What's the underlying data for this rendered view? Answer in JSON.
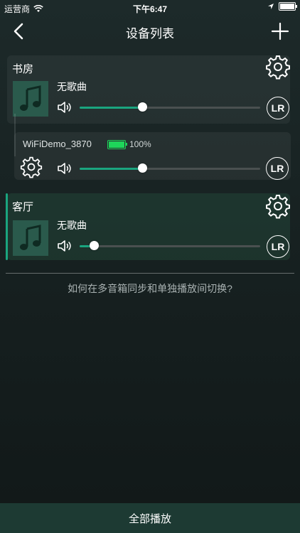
{
  "status_bar": {
    "carrier": "运营商",
    "time": "下午6:47"
  },
  "nav": {
    "title": "设备列表"
  },
  "rooms": [
    {
      "name": "书房",
      "song": "无歌曲",
      "volume": 0.35,
      "channel_label": "LR",
      "device": {
        "name": "WiFiDemo_3870",
        "battery": "100%",
        "volume": 0.35,
        "channel_label": "LR"
      }
    },
    {
      "name": "客厅",
      "song": "无歌曲",
      "volume": 0.08,
      "channel_label": "LR"
    }
  ],
  "help_link": "如何在多音箱同步和单独播放间切换?",
  "bottom_button": "全部播放",
  "colors": {
    "accent": "#1aa57f",
    "battery": "#1ed65a"
  }
}
